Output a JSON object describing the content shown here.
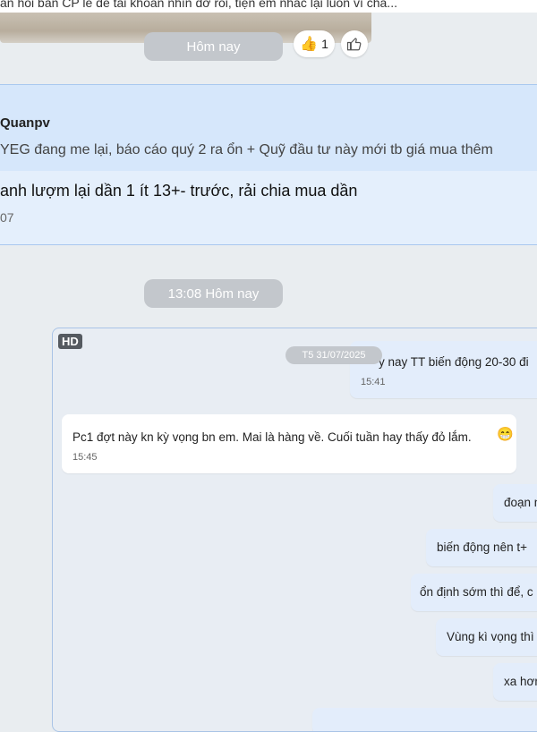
{
  "top_preview": "ần hỏi bán CP lẻ để tài khoản nhìn đỡ rối, tiện em nhắc lại luôn vì chá...",
  "date_separator_1": "Hôm nay",
  "reaction": {
    "emoji": "👍",
    "count": "1"
  },
  "quoted_message": {
    "author": "Quanpv",
    "text": "YEG đang me lại, báo cáo quý 2 ra ổn + Quỹ đầu tư này mới tb giá mua thêm"
  },
  "message": {
    "text": "anh lượm lại dần 1 ít 13+- trước, rải chia mua dần",
    "time": "07"
  },
  "date_separator_2": "13:08 Hôm nay",
  "image": {
    "badge": "HD",
    "inner_date": "T5 31/07/2025",
    "bubbles": [
      {
        "text": "y nay TT biến động 20-30 đi",
        "time": "15:41"
      },
      {
        "text": "Pc1 đợt này kn kỳ vọng bn em. Mai là hàng về. Cuối tuần hay thấy đỏ lắm.",
        "time": "15:45",
        "emoji": "😁"
      },
      {
        "text": "đoạn n"
      },
      {
        "text": "biến động nên t+"
      },
      {
        "text": "ổn định sớm thì để, c"
      },
      {
        "text": "Vùng kì vọng thì"
      },
      {
        "text": "xa hơn"
      }
    ]
  }
}
